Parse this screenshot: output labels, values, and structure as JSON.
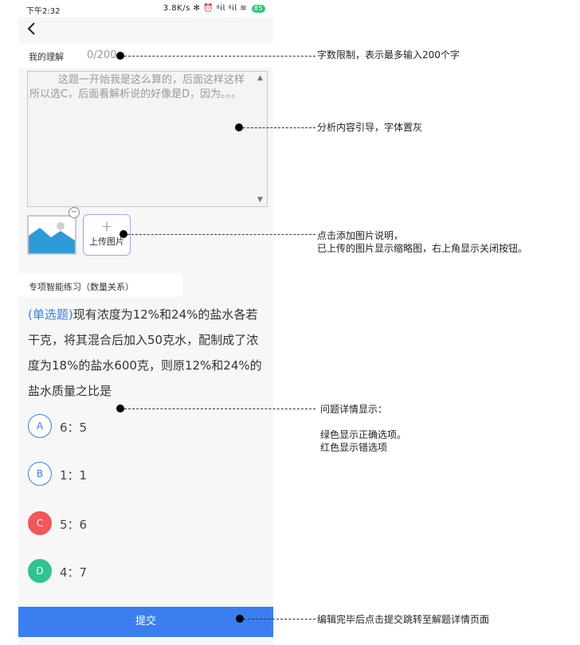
{
  "status": {
    "time": "下午2:32",
    "indicators": "3.8K/s ✻ ⏰ ᵍ𝗂𝗅 ᵍ𝗂𝗅 ≋",
    "battery": "85"
  },
  "nav": {
    "back_icon": "chevron-left-icon"
  },
  "understanding": {
    "label": "我的理解",
    "char_count": "0/200",
    "placeholder": "这题一开始我是这么算的，后面这样这样所以选C，后面看解析说的好像是D，因为。。。"
  },
  "images": {
    "upload_label": "上传图片",
    "close_glyph": "−",
    "plus_glyph": "+"
  },
  "practice": {
    "title": "专项智能练习（数量关系）"
  },
  "question": {
    "type": "(单选题)",
    "text": "现有浓度为12%和24%的盐水各若干克，将其混合后加入50克水，配制成了浓度为18%的盐水600克，则原12%和24%的盐水质量之比是",
    "options": [
      {
        "letter": "A",
        "text": "6：5",
        "state": "normal"
      },
      {
        "letter": "B",
        "text": "1：1",
        "state": "normal"
      },
      {
        "letter": "C",
        "text": "5：6",
        "state": "wrong"
      },
      {
        "letter": "D",
        "text": "4：7",
        "state": "correct"
      }
    ]
  },
  "submit_label": "提交",
  "annotations": [
    {
      "text": "字数限制，表示最多输入200个字"
    },
    {
      "text": "分析内容引导，字体置灰"
    },
    {
      "line1": "点击添加图片说明，",
      "line2": "已上传的图片显示缩略图，右上角显示关闭按钮。"
    },
    {
      "line1": "问题详情显示：",
      "line2": "绿色显示正确选项。",
      "line3": "红色显示错选项"
    },
    {
      "text": "编辑完毕后点击提交跳转至解题详情页面"
    }
  ],
  "colors": {
    "accent": "#3b7ef0",
    "correct": "#2fc48f",
    "wrong": "#f25757"
  }
}
